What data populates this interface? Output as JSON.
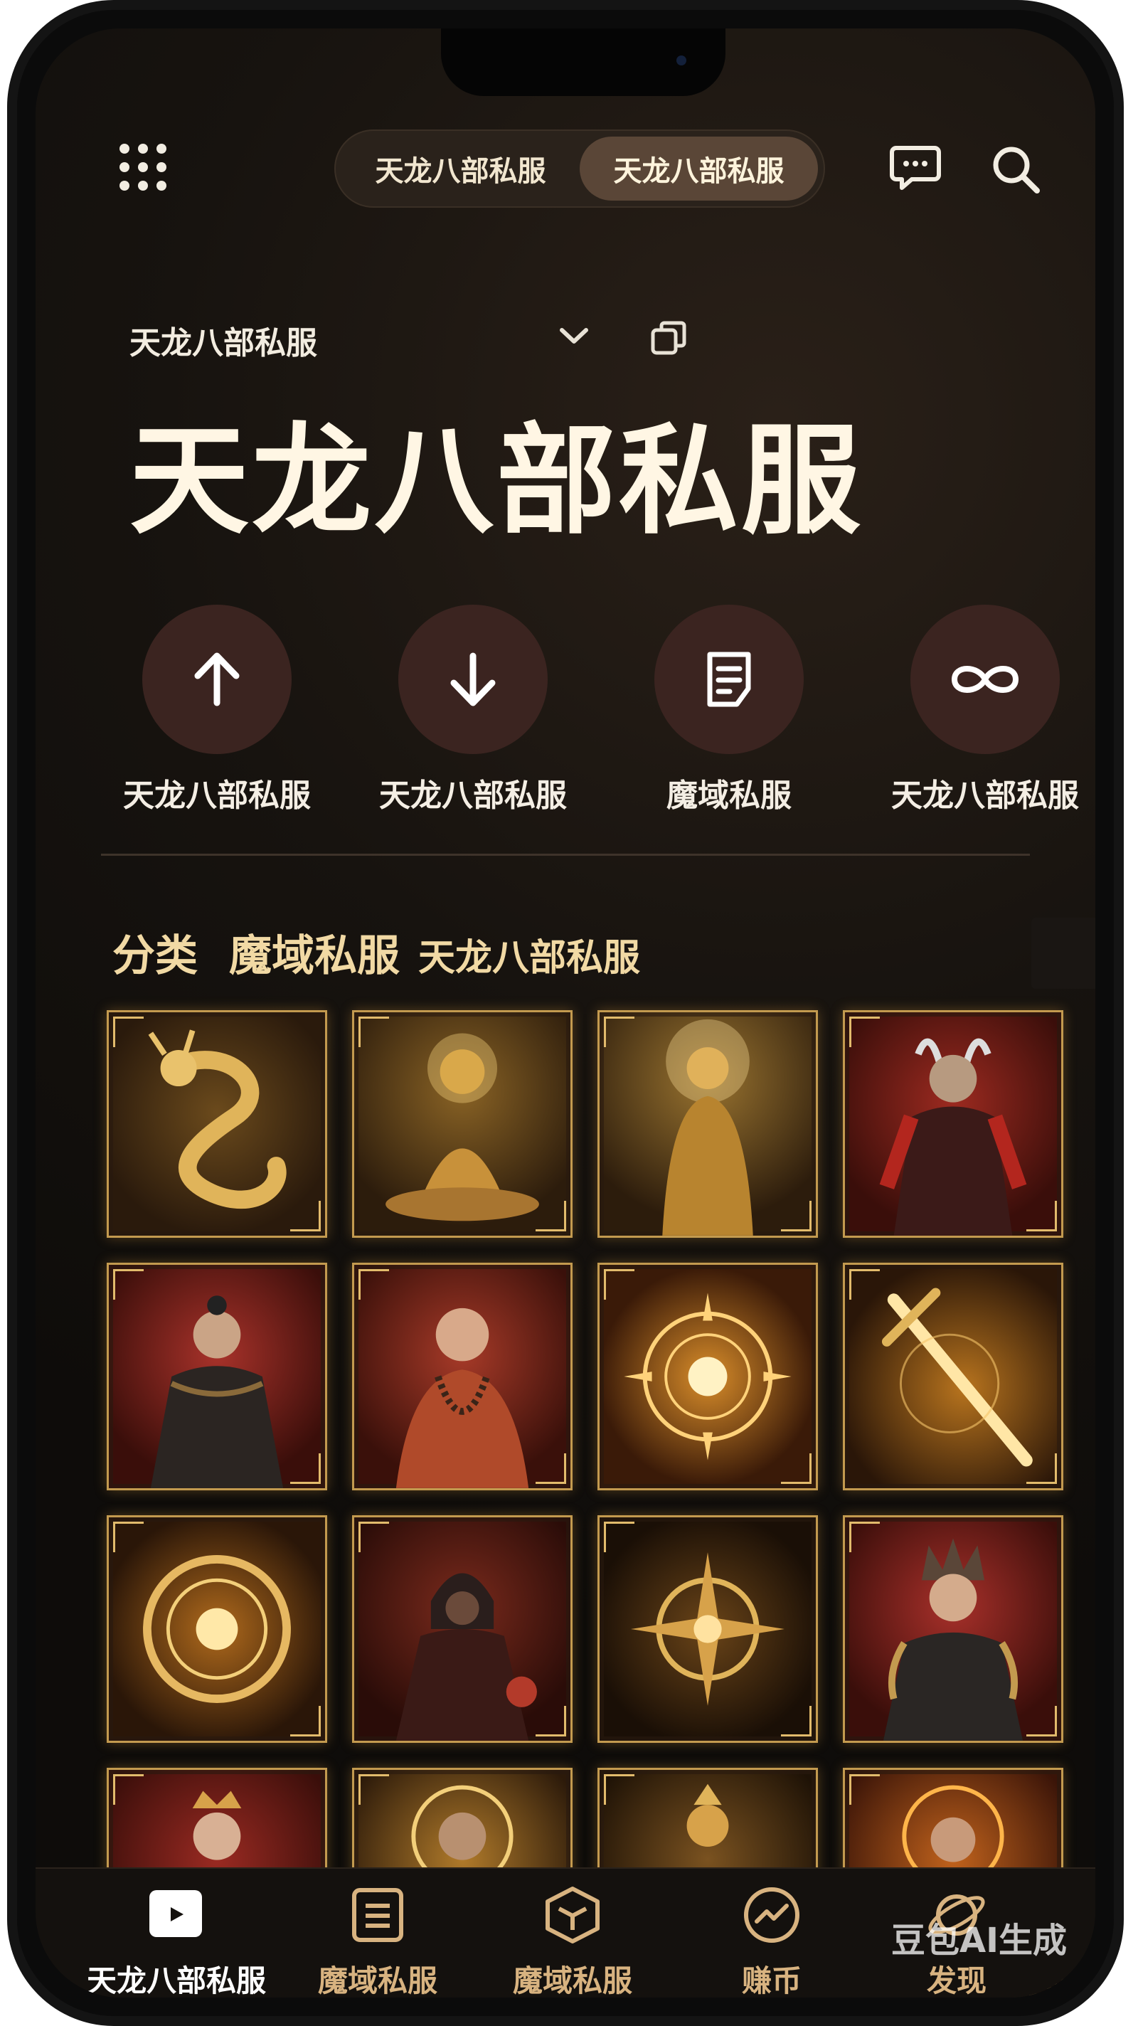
{
  "topbar": {
    "tabs": [
      {
        "label": "天龙八部私服",
        "active": false
      },
      {
        "label": "天龙八部私服",
        "active": true
      }
    ]
  },
  "header": {
    "subtitle": "天龙八部私服",
    "title": "天龙八部私服"
  },
  "actions": [
    {
      "label": "天龙八部私服",
      "icon": "arrow-up-icon"
    },
    {
      "label": "天龙八部私服",
      "icon": "arrow-down-icon"
    },
    {
      "label": "魔域私服",
      "icon": "document-icon"
    },
    {
      "label": "天龙八部私服",
      "icon": "infinity-icon"
    }
  ],
  "categories": {
    "label": "分类",
    "items": [
      "魔域私服",
      "天龙八部私服"
    ]
  },
  "grid": {
    "tiles": [
      {
        "name": "golden-dragon"
      },
      {
        "name": "golden-buddha-seated"
      },
      {
        "name": "golden-buddha-standing"
      },
      {
        "name": "horned-warrior"
      },
      {
        "name": "armored-swordsman"
      },
      {
        "name": "praying-monk"
      },
      {
        "name": "sun-emblem"
      },
      {
        "name": "glowing-sword"
      },
      {
        "name": "golden-seal"
      },
      {
        "name": "hooded-assassin"
      },
      {
        "name": "compass-emblem"
      },
      {
        "name": "spiky-hair-warrior"
      },
      {
        "name": "crowned-lady"
      },
      {
        "name": "warrior-portrait"
      },
      {
        "name": "golden-idol"
      },
      {
        "name": "fire-warrior"
      }
    ]
  },
  "bottom_nav": [
    {
      "label": "天龙八部私服",
      "icon": "play-icon",
      "active": true
    },
    {
      "label": "魔域私服",
      "icon": "list-icon",
      "active": false
    },
    {
      "label": "魔域私服",
      "icon": "hexagon-icon",
      "active": false
    },
    {
      "label": "赚币",
      "icon": "trend-icon",
      "active": false
    },
    {
      "label": "发现",
      "icon": "planet-icon",
      "active": false
    }
  ],
  "watermark": "豆包AI生成",
  "colors": {
    "background": "#0e0c0a",
    "accent_gold": "#c39a4f",
    "circle_bg": "#3b2420",
    "category_text": "#f1d9a4"
  }
}
